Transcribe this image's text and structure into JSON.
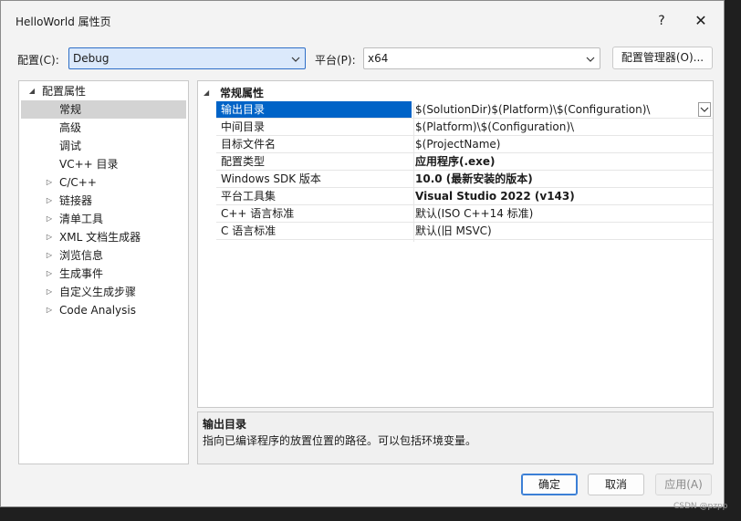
{
  "window": {
    "title": "HelloWorld 属性页",
    "help_label": "?",
    "close_label": "✕"
  },
  "toolbar": {
    "config_label": "配置(C):",
    "config_value": "Debug",
    "platform_label": "平台(P):",
    "platform_value": "x64",
    "config_manager_label": "配置管理器(O)..."
  },
  "tree": {
    "root": "配置属性",
    "items": [
      {
        "label": "常规",
        "expandable": false,
        "selected": true
      },
      {
        "label": "高级",
        "expandable": false
      },
      {
        "label": "调试",
        "expandable": false
      },
      {
        "label": "VC++ 目录",
        "expandable": false
      },
      {
        "label": "C/C++",
        "expandable": true
      },
      {
        "label": "链接器",
        "expandable": true
      },
      {
        "label": "清单工具",
        "expandable": true
      },
      {
        "label": "XML 文档生成器",
        "expandable": true
      },
      {
        "label": "浏览信息",
        "expandable": true
      },
      {
        "label": "生成事件",
        "expandable": true
      },
      {
        "label": "自定义生成步骤",
        "expandable": true
      },
      {
        "label": "Code Analysis",
        "expandable": true
      }
    ]
  },
  "grid": {
    "section": "常规属性",
    "rows": [
      {
        "name": "输出目录",
        "value": "$(SolutionDir)$(Platform)\\$(Configuration)\\",
        "bold": false
      },
      {
        "name": "中间目录",
        "value": "$(Platform)\\$(Configuration)\\",
        "bold": false
      },
      {
        "name": "目标文件名",
        "value": "$(ProjectName)",
        "bold": false
      },
      {
        "name": "配置类型",
        "value": "应用程序(.exe)",
        "bold": true
      },
      {
        "name": "Windows SDK 版本",
        "value": "10.0 (最新安装的版本)",
        "bold": true
      },
      {
        "name": "平台工具集",
        "value": "Visual Studio 2022 (v143)",
        "bold": true
      },
      {
        "name": "C++ 语言标准",
        "value": "默认(ISO C++14 标准)",
        "bold": false
      },
      {
        "name": "C 语言标准",
        "value": "默认(旧 MSVC)",
        "bold": false
      }
    ]
  },
  "description": {
    "title": "输出目录",
    "text": "指向已编译程序的放置位置的路径。可以包括环境变量。"
  },
  "buttons": {
    "ok": "确定",
    "cancel": "取消",
    "apply": "应用(A)"
  },
  "watermark": "CSDN @pzpp"
}
